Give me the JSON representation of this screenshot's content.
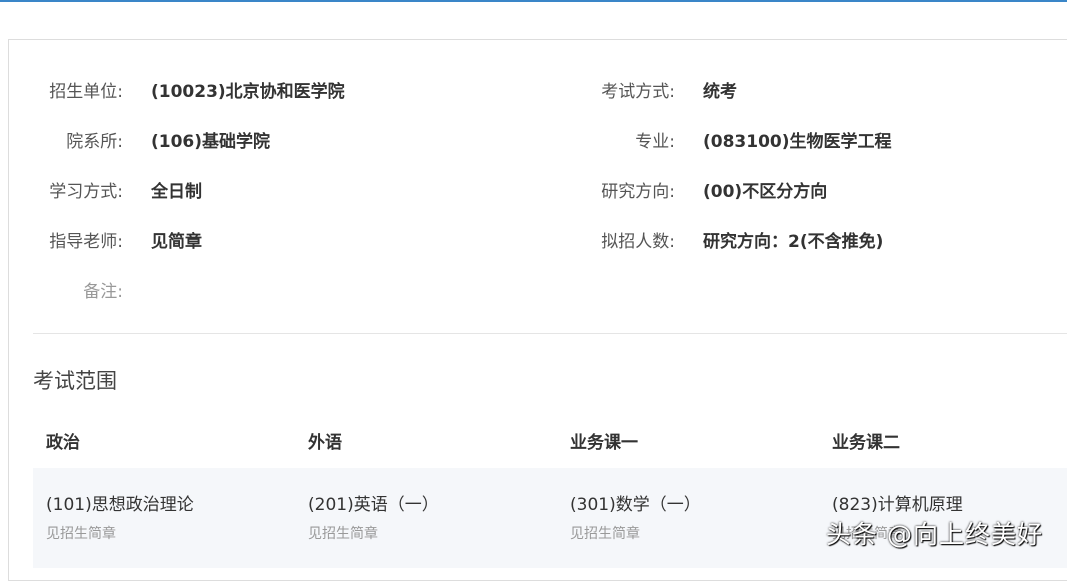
{
  "info": [
    {
      "label": "招生单位:",
      "value": "(10023)北京协和医学院"
    },
    {
      "label": "考试方式:",
      "value": "统考"
    },
    {
      "label": "院系所:",
      "value": "(106)基础学院"
    },
    {
      "label": "专业:",
      "value": "(083100)生物医学工程"
    },
    {
      "label": "学习方式:",
      "value": "全日制"
    },
    {
      "label": "研究方向:",
      "value": "(00)不区分方向"
    },
    {
      "label": "指导老师:",
      "value": "见简章"
    },
    {
      "label": "拟招人数:",
      "value": "研究方向：2(不含推免)"
    },
    {
      "label": "备注:",
      "value": ""
    }
  ],
  "section_title": "考试范围",
  "columns": [
    "政治",
    "外语",
    "业务课一",
    "业务课二"
  ],
  "subjects": [
    {
      "name": "(101)思想政治理论",
      "note": "见招生简章"
    },
    {
      "name": "(201)英语（一）",
      "note": "见招生简章"
    },
    {
      "name": "(301)数学（一）",
      "note": "见招生简章"
    },
    {
      "name": "(823)计算机原理",
      "note": "见招生简章"
    }
  ],
  "watermark": "头条 @向上终美好"
}
